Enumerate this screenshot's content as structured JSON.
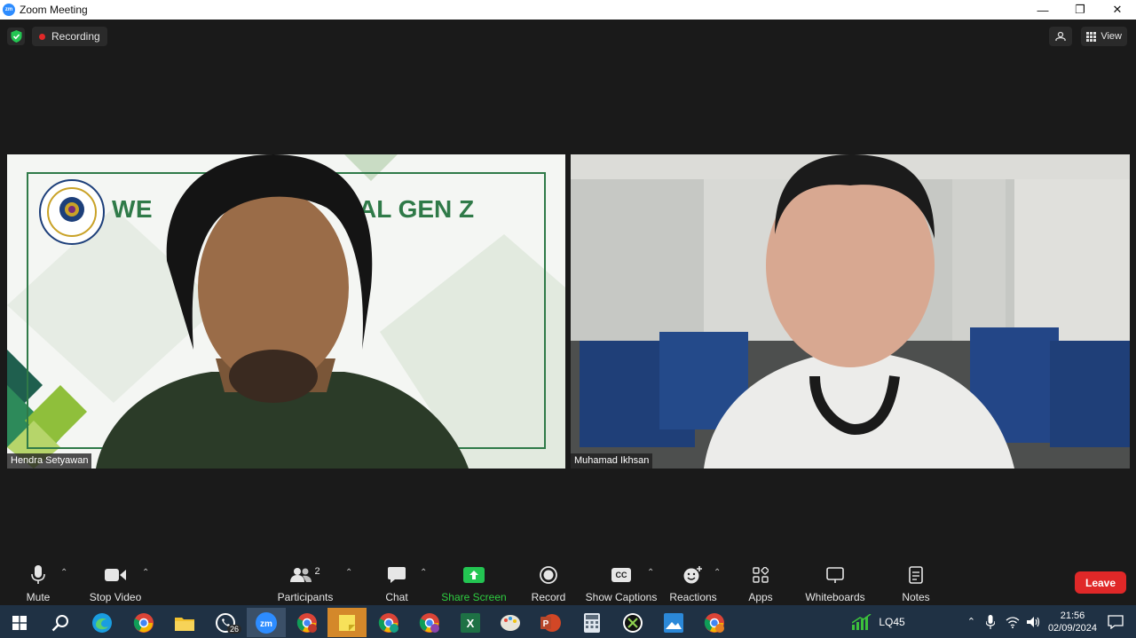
{
  "window": {
    "title": "Zoom Meeting",
    "logo_text": "zm",
    "minimize": "—",
    "restore": "❐",
    "close": "✕"
  },
  "meeting": {
    "recording_label": "Recording",
    "view_label": "View",
    "colors": {
      "background": "#1a1a1a",
      "accent_green": "#2ecc40",
      "leave_red": "#e02828"
    }
  },
  "participants": [
    {
      "name": "Hendra Setyawan",
      "banner_left": "WE",
      "banner_right": "AL GEN Z"
    },
    {
      "name": "Muhamad Ikhsan"
    }
  ],
  "toolbar": {
    "mute": "Mute",
    "stop_video": "Stop Video",
    "participants": "Participants",
    "participants_count": "2",
    "chat": "Chat",
    "share_screen": "Share Screen",
    "record": "Record",
    "show_captions": "Show Captions",
    "cc_text": "CC",
    "reactions": "Reactions",
    "apps": "Apps",
    "whiteboards": "Whiteboards",
    "notes": "Notes",
    "leave": "Leave"
  },
  "taskbar": {
    "whatsapp_badge": "26",
    "stock_label": "LQ45",
    "time": "21:56",
    "date": "02/09/2024",
    "apps": [
      "windows-start",
      "search",
      "edge",
      "chrome-1",
      "file-explorer",
      "whatsapp",
      "zoom",
      "chrome-b",
      "sticky-notes",
      "chrome-i",
      "chrome-m",
      "excel",
      "paint",
      "powerpoint",
      "calculator",
      "app-x",
      "photos",
      "chrome-2"
    ]
  }
}
